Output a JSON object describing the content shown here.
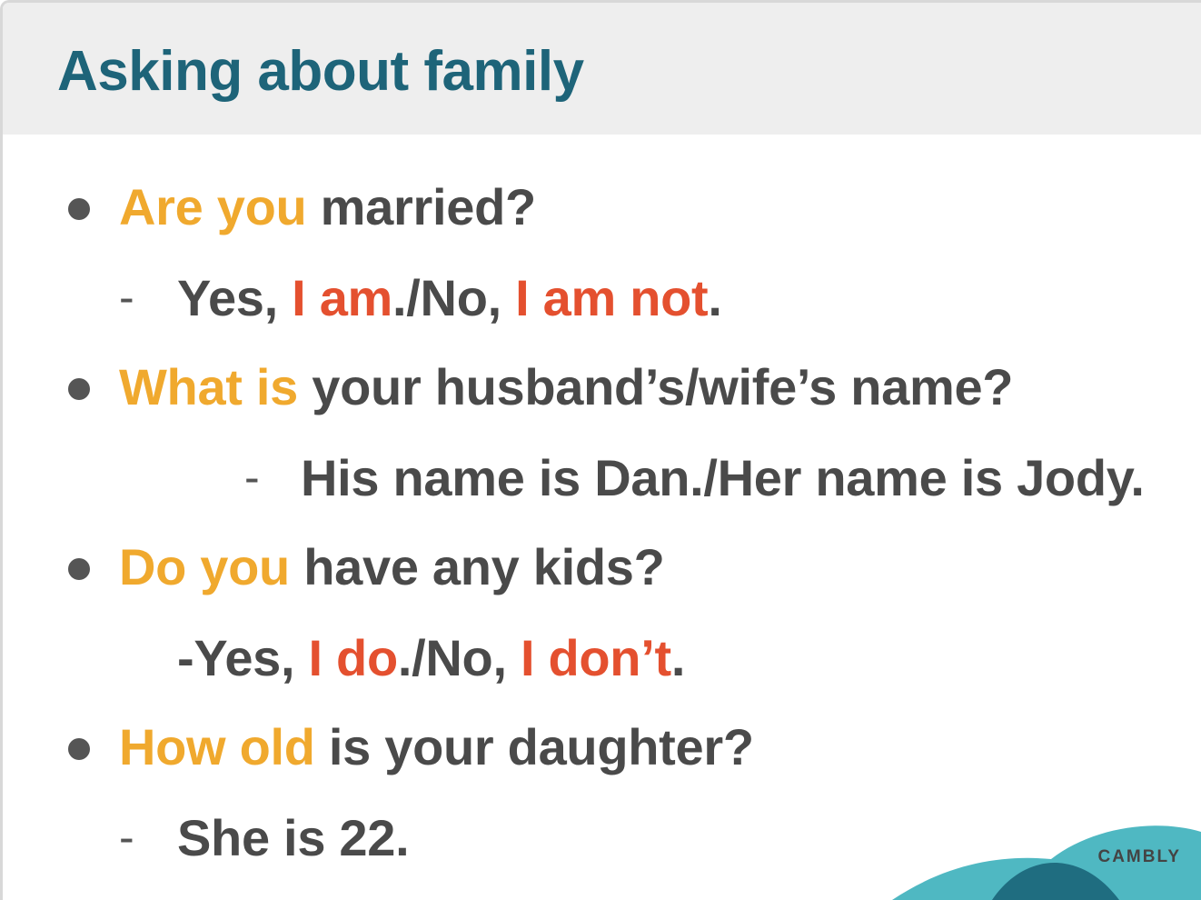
{
  "title": "Asking about family",
  "items": [
    {
      "question": {
        "highlight": "Are you",
        "rest": " married?"
      },
      "answer": {
        "prefix": "-",
        "parts": [
          "Yes, ",
          "I am",
          "./No, ",
          "I am not",
          "."
        ]
      }
    },
    {
      "question": {
        "highlight": "What is",
        "rest": " your husband’s/wife’s name?"
      },
      "answer": {
        "prefix": "-",
        "parts": [
          "His name is Dan./Her name is Jody."
        ]
      }
    },
    {
      "question": {
        "highlight": "Do you",
        "rest": " have any kids?"
      },
      "answer": {
        "prefix": "-",
        "parts": [
          "Yes, ",
          "I do",
          "./No, ",
          "I don’t",
          "."
        ]
      }
    },
    {
      "question": {
        "highlight": "How old",
        "rest": " is your daughter?"
      },
      "answer": {
        "prefix": "-",
        "parts": [
          "She is 22."
        ]
      }
    }
  ],
  "logo": {
    "text": "CAMBLY"
  },
  "colors": {
    "title": "#1e6479",
    "question_highlight": "#f0a92e",
    "answer_highlight": "#e4502f",
    "body_text": "#4a4a4a",
    "logo_teal_light": "#4fb8c2",
    "logo_teal_dark": "#1f6d80"
  }
}
